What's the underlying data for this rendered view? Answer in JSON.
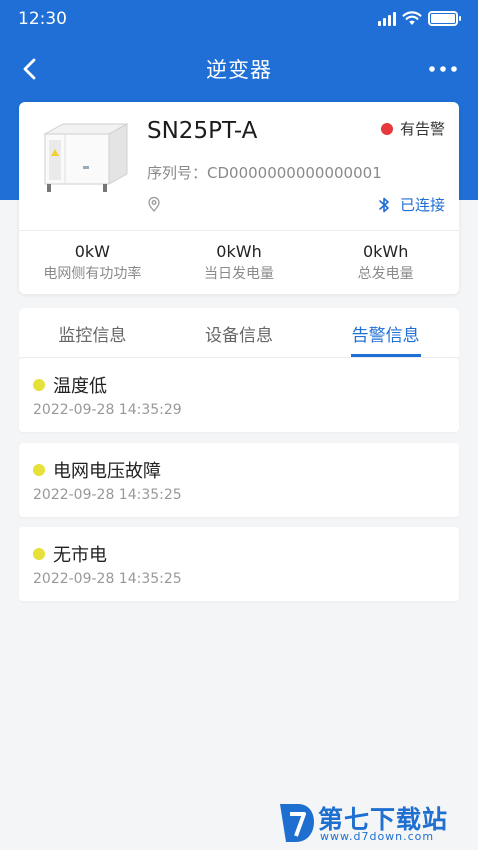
{
  "status_bar": {
    "time": "12:30"
  },
  "nav": {
    "title": "逆变器",
    "back_icon": "chevron-left-icon",
    "more_icon": "more-horizontal-icon"
  },
  "device": {
    "model": "SN25PT-A",
    "alarm_status": "有告警",
    "alarm_color": "#e5393b",
    "serial_label": "序列号：",
    "serial_value": "CD0000000000000001",
    "connection_status": "已连接",
    "connection_icon": "bluetooth-icon",
    "location_icon": "location-pin-icon",
    "stats": [
      {
        "value": "0kW",
        "label": "电网侧有功功率"
      },
      {
        "value": "0kWh",
        "label": "当日发电量"
      },
      {
        "value": "0kWh",
        "label": "总发电量"
      }
    ]
  },
  "tabs": [
    {
      "label": "监控信息",
      "active": false
    },
    {
      "label": "设备信息",
      "active": false
    },
    {
      "label": "告警信息",
      "active": true
    }
  ],
  "alarms": [
    {
      "title": "温度低",
      "time": "2022-09-28 14:35:29"
    },
    {
      "title": "电网电压故障",
      "time": "2022-09-28 14:35:25"
    },
    {
      "title": "无市电",
      "time": "2022-09-28 14:35:25"
    }
  ],
  "colors": {
    "primary": "#1f6fd6",
    "alarm_dot": "#e6e03a",
    "background": "#f4f5f7"
  },
  "watermark": {
    "name": "第七下载站",
    "url": "www.d7down.com"
  }
}
